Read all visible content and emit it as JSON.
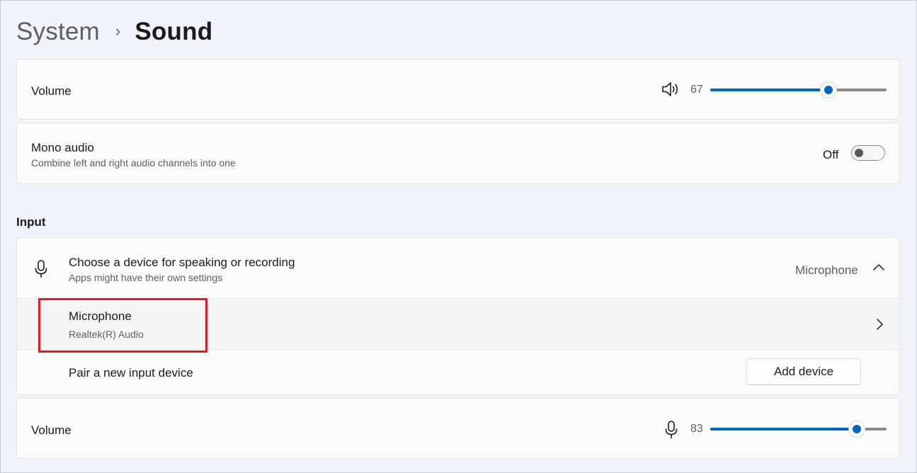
{
  "breadcrumb": {
    "parent": "System",
    "separator": "›",
    "current": "Sound"
  },
  "output_volume": {
    "label": "Volume",
    "icon": "speaker-icon",
    "value_text": "67",
    "level_percent": 67
  },
  "mono_audio": {
    "label": "Mono audio",
    "description": "Combine left and right audio channels into one",
    "state_label": "Off",
    "on": false
  },
  "input": {
    "section_title": "Input",
    "choose_device": {
      "icon": "microphone-icon",
      "label": "Choose a device for speaking or recording",
      "description": "Apps might have their own settings",
      "selected_value": "Microphone",
      "expander_icon": "chevron-up-icon"
    },
    "device": {
      "name": "Microphone",
      "detail": "Realtek(R) Audio",
      "chevron_icon": "chevron-right-icon"
    },
    "pair": {
      "label": "Pair a new input device",
      "button_label": "Add device"
    },
    "volume": {
      "label": "Volume",
      "icon": "microphone-icon",
      "value_text": "83",
      "level_percent": 83
    }
  },
  "colors": {
    "accent": "#0067c0",
    "highlight": "#e01b24",
    "background": "#f0f3f9",
    "card": "#fbfbfc"
  }
}
